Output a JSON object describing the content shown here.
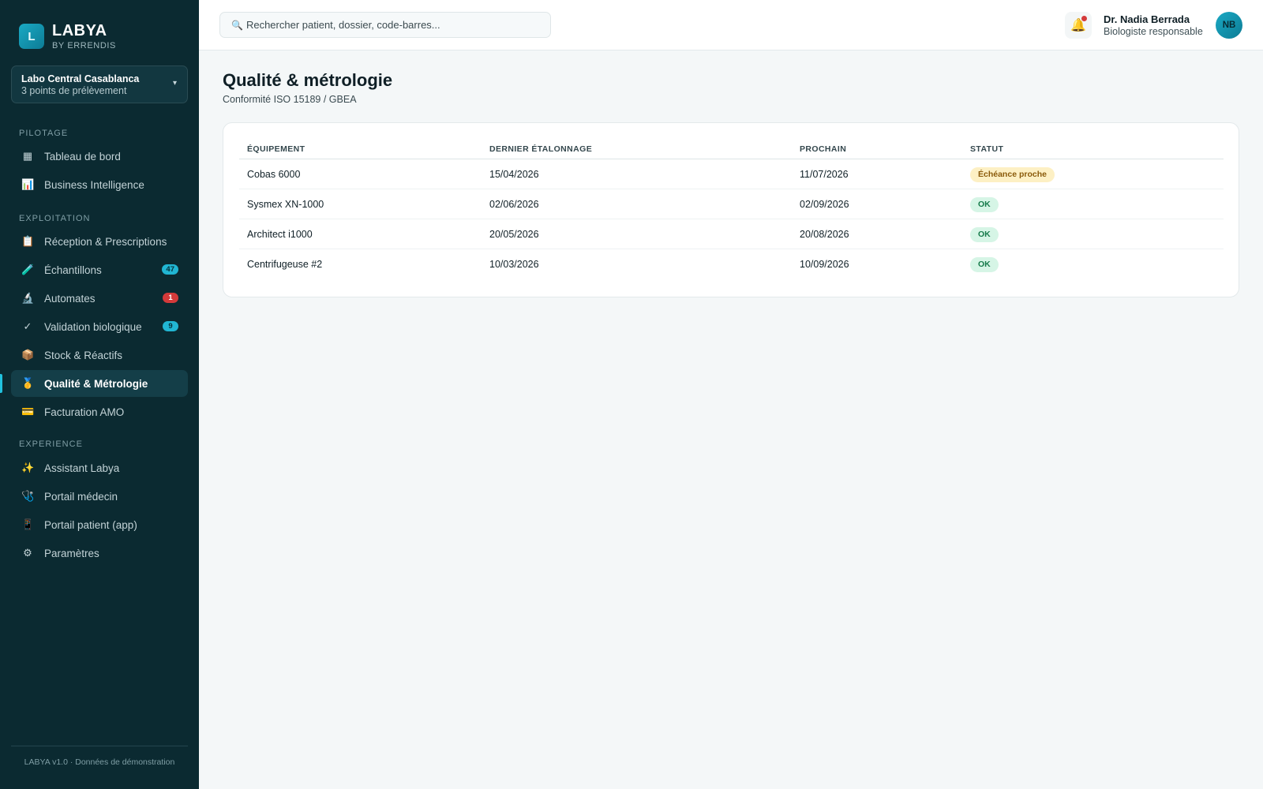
{
  "brand": {
    "logo_letter": "L",
    "name": "LABYA",
    "sub": "BY ERRENDIS"
  },
  "lab": {
    "name": "Labo Central Casablanca",
    "sub": "3 points de prélèvement",
    "chevron": "▾"
  },
  "nav": {
    "sections": [
      "PILOTAGE",
      "EXPLOITATION",
      "EXPERIENCE"
    ],
    "items": [
      {
        "label": "Tableau de bord",
        "icon": "▦",
        "icon_name": "dashboard-icon"
      },
      {
        "label": "Business Intelligence",
        "icon": "📊",
        "icon_name": "bar-chart-icon"
      },
      {
        "label": "Réception & Prescriptions",
        "icon": "📋",
        "icon_name": "clipboard-icon"
      },
      {
        "label": "Échantillons",
        "icon": "🧪",
        "icon_name": "test-tube-icon",
        "badge": "47"
      },
      {
        "label": "Automates",
        "icon": "🔬",
        "icon_name": "microscope-icon",
        "badge": "1"
      },
      {
        "label": "Validation biologique",
        "icon": "✓",
        "icon_name": "check-icon",
        "badge": "9"
      },
      {
        "label": "Stock & Réactifs",
        "icon": "📦",
        "icon_name": "package-icon"
      },
      {
        "label": "Qualité & Métrologie",
        "icon": "🥇",
        "icon_name": "medal-icon",
        "active": true
      },
      {
        "label": "Facturation AMO",
        "icon": "💳",
        "icon_name": "credit-card-icon"
      },
      {
        "label": "Assistant Labya",
        "icon": "✨",
        "icon_name": "sparkles-icon"
      },
      {
        "label": "Portail médecin",
        "icon": "🩺",
        "icon_name": "stethoscope-icon"
      },
      {
        "label": "Portail patient (app)",
        "icon": "📱",
        "icon_name": "mobile-icon"
      },
      {
        "label": "Paramètres",
        "icon": "⚙",
        "icon_name": "gear-icon"
      }
    ]
  },
  "footer": "LABYA v1.0 · Données de démonstration",
  "search": {
    "icon": "🔍",
    "placeholder": "Rechercher patient, dossier, code-barres..."
  },
  "notifications": {
    "icon": "🔔",
    "has_unread": true
  },
  "user": {
    "name": "Dr. Nadia Berrada",
    "role": "Biologiste responsable",
    "initials": "NB"
  },
  "page": {
    "title": "Qualité & métrologie",
    "subtitle": "Conformité ISO 15189 / GBEA"
  },
  "table": {
    "headers": [
      "ÉQUIPEMENT",
      "DERNIER ÉTALONNAGE",
      "PROCHAIN",
      "STATUT"
    ],
    "rows": [
      {
        "equipment": "Cobas 6000",
        "last": "15/04/2026",
        "next": "11/07/2026",
        "status": "Échéance proche",
        "status_type": "warn"
      },
      {
        "equipment": "Sysmex XN-1000",
        "last": "02/06/2026",
        "next": "02/09/2026",
        "status": "OK",
        "status_type": "ok"
      },
      {
        "equipment": "Architect i1000",
        "last": "20/05/2026",
        "next": "20/08/2026",
        "status": "OK",
        "status_type": "ok"
      },
      {
        "equipment": "Centrifugeuse #2",
        "last": "10/03/2026",
        "next": "10/09/2026",
        "status": "OK",
        "status_type": "ok"
      }
    ]
  },
  "colors": {
    "sidebar_bg": "#0b2a31",
    "accent": "#21b6d3",
    "danger": "#d43a3a",
    "warn_bg": "#fdf0c4",
    "ok_bg": "#d6f5e6"
  }
}
